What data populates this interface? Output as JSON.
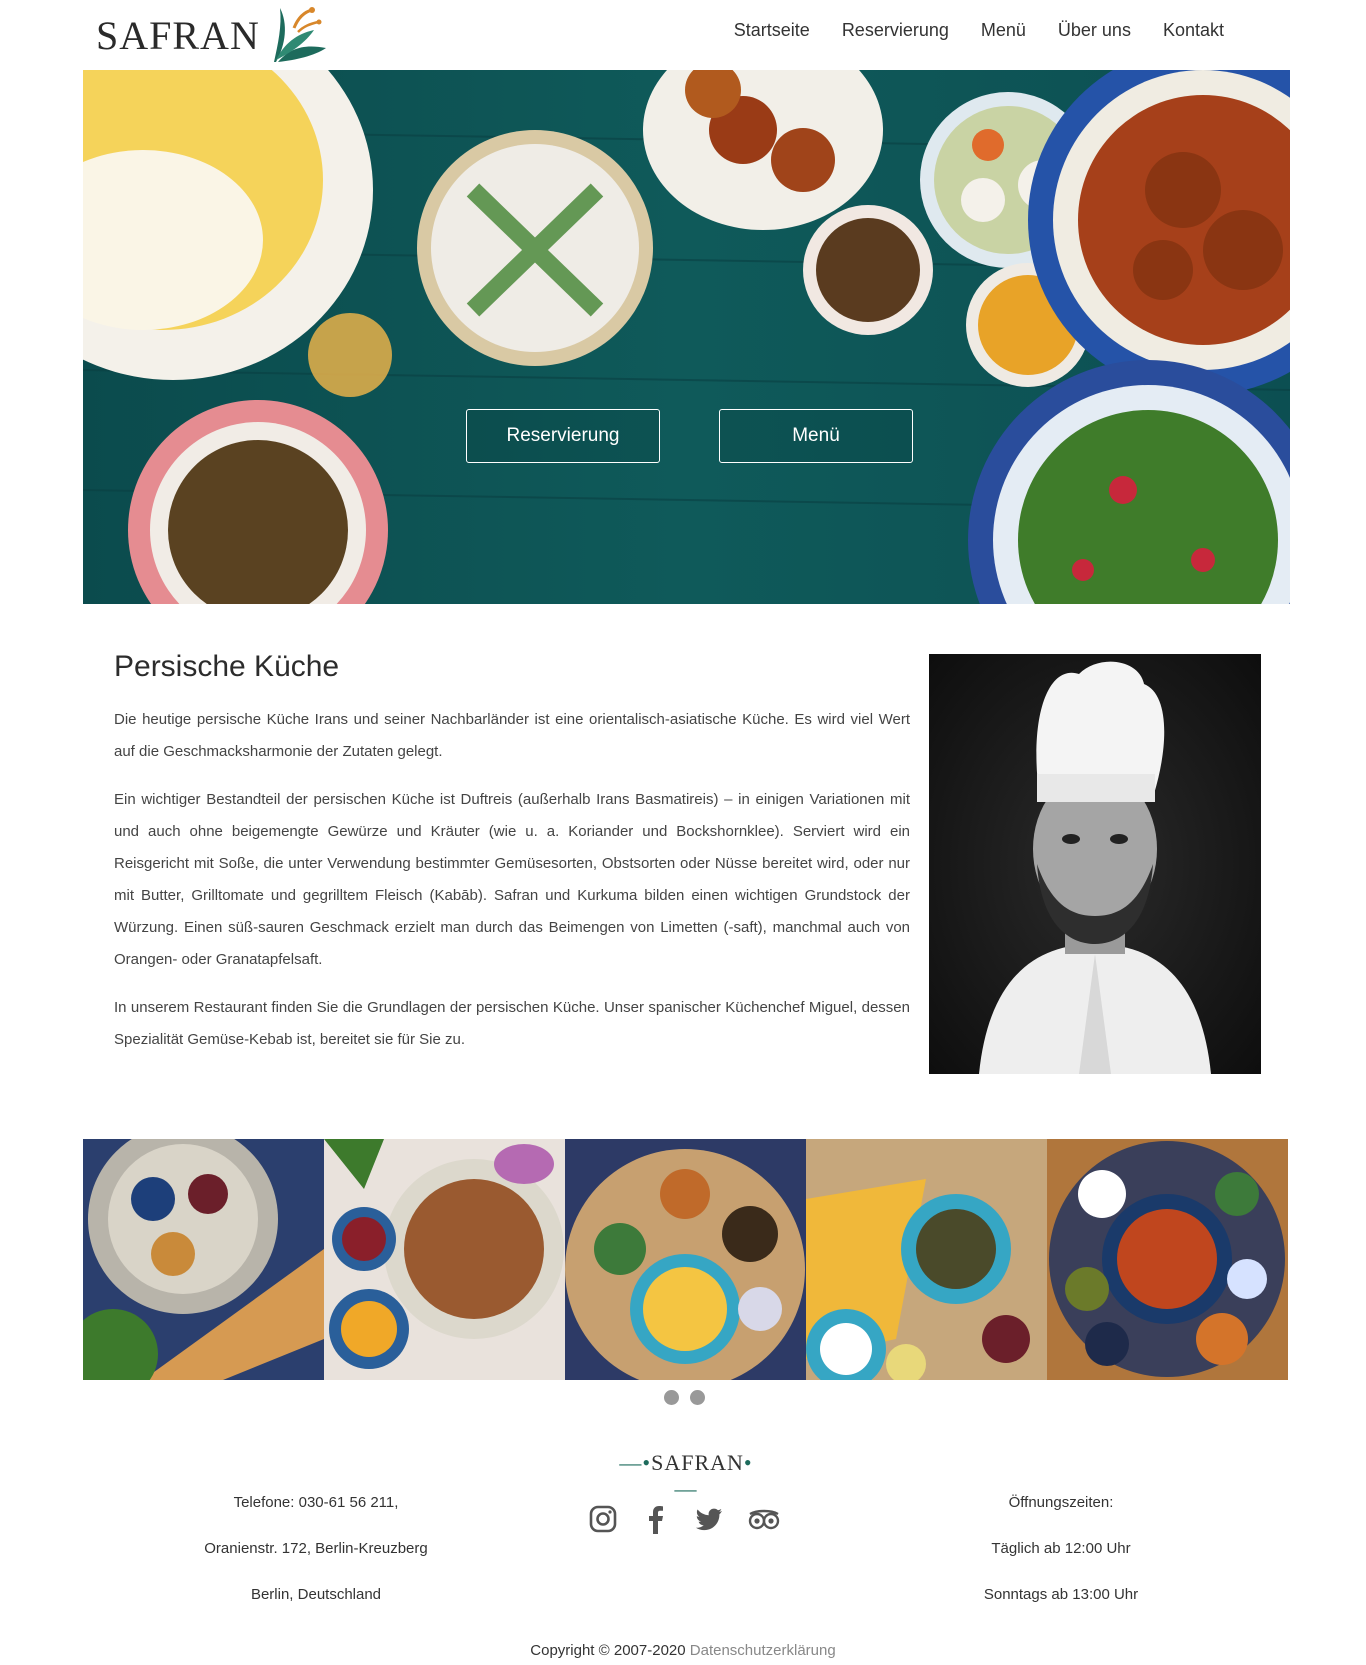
{
  "brand": {
    "name": "SAFRAN"
  },
  "nav": {
    "items": [
      {
        "label": "Startseite"
      },
      {
        "label": "Reservierung"
      },
      {
        "label": "Menü"
      },
      {
        "label": "Über uns"
      },
      {
        "label": "Kontakt"
      }
    ]
  },
  "hero": {
    "reserve_label": "Reservierung",
    "menu_label": "Menü"
  },
  "intro": {
    "title": "Persische Küche",
    "paragraphs": [
      "Die heutige persische Küche Irans und seiner Nachbarländer ist eine orientalisch-asiatische Küche. Es wird viel Wert auf die Geschmacksharmonie der Zutaten gelegt.",
      "Ein wichtiger Bestandteil der persischen Küche ist Duftreis (außerhalb Irans Basmatireis) – in einigen Variationen mit und auch ohne beigemengte Gewürze und Kräuter (wie u. a. Koriander und Bockshornklee). Serviert wird ein Reisgericht mit Soße, die unter Verwendung bestimmter Gemüsesorten, Obstsorten oder Nüsse bereitet wird, oder nur mit Butter, Grilltomate und gegrilltem Fleisch (Kabāb). Safran und Kurkuma bilden einen wichtigen Grundstock der Würzung. Einen süß-sauren Geschmack erzielt man durch das Beimengen von Limetten (-saft), manchmal auch von Orangen- oder Granatapfelsaft.",
      "In unserem Restaurant finden Sie die Grundlagen der persischen Küche. Unser spanischer Küchenchef Miguel, dessen Spezialität Gemüse-Kebab ist, bereitet sie für Sie zu."
    ]
  },
  "footer": {
    "logo": "SAFRAN",
    "contact": [
      "Telefone: 030-61 56 211,",
      "Oranienstr. 172, Berlin-Kreuzberg",
      "Berlin, Deutschland"
    ],
    "hours": [
      "Öffnungszeiten:",
      "Täglich ab 12:00 Uhr",
      "Sonntags ab 13:00 Uhr"
    ],
    "social": [
      "instagram-icon",
      "facebook-icon",
      "twitter-icon",
      "tripadvisor-icon"
    ],
    "copyright": "Copyright © 2007-2020",
    "privacy_link": "Datenschutzerklärung"
  },
  "colors": {
    "brand_green": "#1d6b5c",
    "hero_table": "#0e4f51"
  }
}
